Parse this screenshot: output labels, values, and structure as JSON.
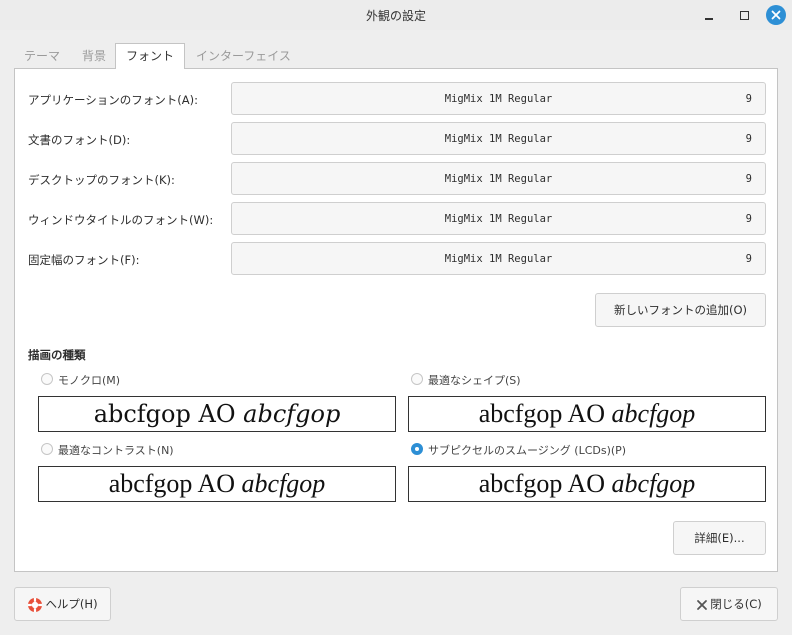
{
  "window": {
    "title": "外観の設定"
  },
  "tabs": [
    {
      "label": "テーマ"
    },
    {
      "label": "背景"
    },
    {
      "label": "フォント"
    },
    {
      "label": "インターフェイス"
    }
  ],
  "fonts": [
    {
      "label": "アプリケーションのフォント(A):",
      "font": "MigMix 1M Regular",
      "size": "9"
    },
    {
      "label": "文書のフォント(D):",
      "font": "MigMix 1M Regular",
      "size": "9"
    },
    {
      "label": "デスクトップのフォント(K):",
      "font": "MigMix 1M Regular",
      "size": "9"
    },
    {
      "label": "ウィンドウタイトルのフォント(W):",
      "font": "MigMix 1M Regular",
      "size": "9"
    },
    {
      "label": "固定幅のフォント(F):",
      "font": "MigMix 1M Regular",
      "size": "9"
    }
  ],
  "add_font_button": "新しいフォントの追加(O)",
  "rendering": {
    "title": "描画の種類",
    "options": [
      {
        "label": "モノクロ(M)",
        "sample_regular": "abcfgop AO",
        "sample_italic": "abcfgop",
        "selected": false
      },
      {
        "label": "最適なシェイプ(S)",
        "sample_regular": "abcfgop AO",
        "sample_italic": "abcfgop",
        "selected": false
      },
      {
        "label": "最適なコントラスト(N)",
        "sample_regular": "abcfgop AO",
        "sample_italic": "abcfgop",
        "selected": false
      },
      {
        "label": "サブピクセルのスムージング (LCDs)(P)",
        "sample_regular": "abcfgop AO",
        "sample_italic": "abcfgop",
        "selected": true
      }
    ]
  },
  "details_button": "詳細(E)...",
  "help_button": "ヘルプ(H)",
  "close_button": "閉じる(C)",
  "colors": {
    "accent": "#2d8fd5"
  }
}
